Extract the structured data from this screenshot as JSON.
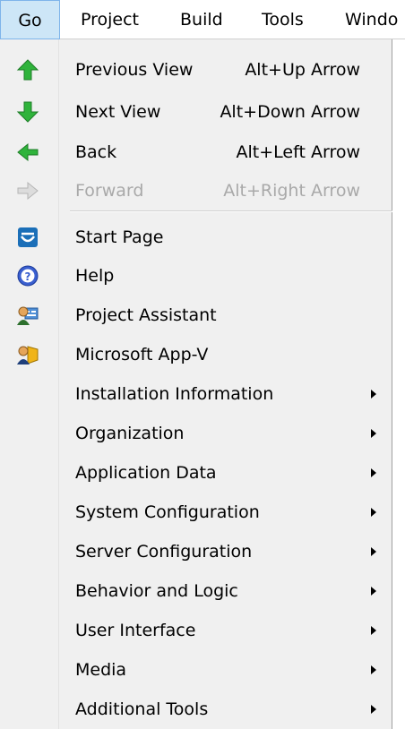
{
  "menubar": {
    "items": [
      {
        "label": "Go"
      },
      {
        "label": "Project"
      },
      {
        "label": "Build"
      },
      {
        "label": "Tools"
      },
      {
        "label": "Windo"
      }
    ]
  },
  "menu": {
    "items": [
      {
        "label": "Previous View",
        "accel": "Alt+Up Arrow",
        "icon": "up-arrow-icon"
      },
      {
        "label": "Next View",
        "accel": "Alt+Down Arrow",
        "icon": "down-arrow-icon"
      },
      {
        "label": "Back",
        "accel": "Alt+Left Arrow",
        "icon": "left-arrow-icon"
      },
      {
        "label": "Forward",
        "accel": "Alt+Right Arrow",
        "icon": "right-arrow-icon",
        "disabled": true
      },
      {
        "label": "Start Page",
        "icon": "start-page-icon"
      },
      {
        "label": "Help",
        "icon": "help-icon"
      },
      {
        "label": "Project Assistant",
        "icon": "project-assistant-icon"
      },
      {
        "label": "Microsoft App-V",
        "icon": "app-v-icon"
      },
      {
        "label": "Installation Information",
        "submenu": true
      },
      {
        "label": "Organization",
        "submenu": true
      },
      {
        "label": "Application Data",
        "submenu": true
      },
      {
        "label": "System Configuration",
        "submenu": true
      },
      {
        "label": "Server Configuration",
        "submenu": true
      },
      {
        "label": "Behavior and Logic",
        "submenu": true
      },
      {
        "label": "User Interface",
        "submenu": true
      },
      {
        "label": "Media",
        "submenu": true
      },
      {
        "label": "Additional Tools",
        "submenu": true
      }
    ]
  },
  "colors": {
    "menu_background": "#f0f0f0",
    "active_menubar_item": "#cde6f7",
    "disabled_text": "#a9a9a9",
    "arrow_green": "#2fb33b"
  }
}
